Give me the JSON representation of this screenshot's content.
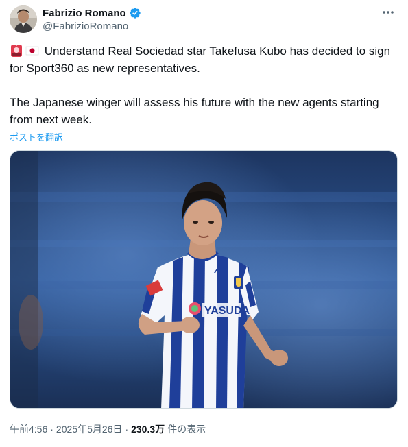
{
  "author": {
    "display_name": "Fabrizio Romano",
    "handle": "@FabrizioRomano",
    "verified": true
  },
  "tweet": {
    "emojis": [
      "police-light-emoji",
      "japan-flag-emoji"
    ],
    "line1": "Understand Real Sociedad star Takefusa Kubo has decided to sign for Sport360 as new representatives.",
    "line2": "The Japanese winger will assess his future with the new agents starting from next week.",
    "translate_label": "ポストを翻訳"
  },
  "media": {
    "shirt_sponsor": "YASUDA"
  },
  "meta": {
    "time": "午前4:56",
    "date": "2025年5月26日",
    "separator": "·",
    "views_count": "230.3万",
    "views_label": "件の表示"
  },
  "colors": {
    "link": "#1d9bf0",
    "verified": "#1d9bf0",
    "secondary_text": "#536471",
    "primary_text": "#0f1419"
  },
  "icons": {
    "verified": "verified-badge-icon",
    "more": "more-horizontal-icon"
  }
}
